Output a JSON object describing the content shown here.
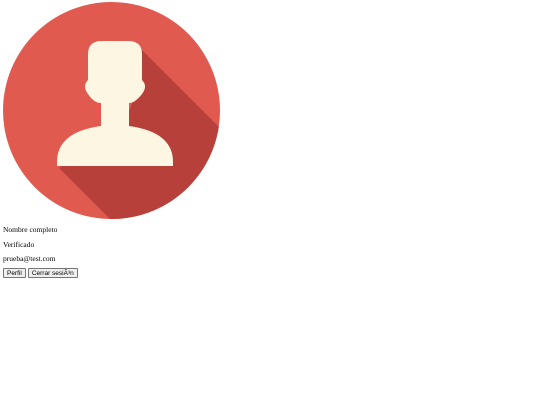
{
  "profile": {
    "avatar_icon": "user-avatar-icon",
    "avatar_colors": {
      "circle": "#e05a4f",
      "shadow": "#b8403a",
      "silhouette": "#fdf6e3"
    },
    "name_label": "Nombre completo",
    "verified_label": "Verificado",
    "email": "prueba@test.com"
  },
  "actions": {
    "profile_label": "Perfil",
    "logout_label": "Cerrar sesiÃ³n"
  }
}
